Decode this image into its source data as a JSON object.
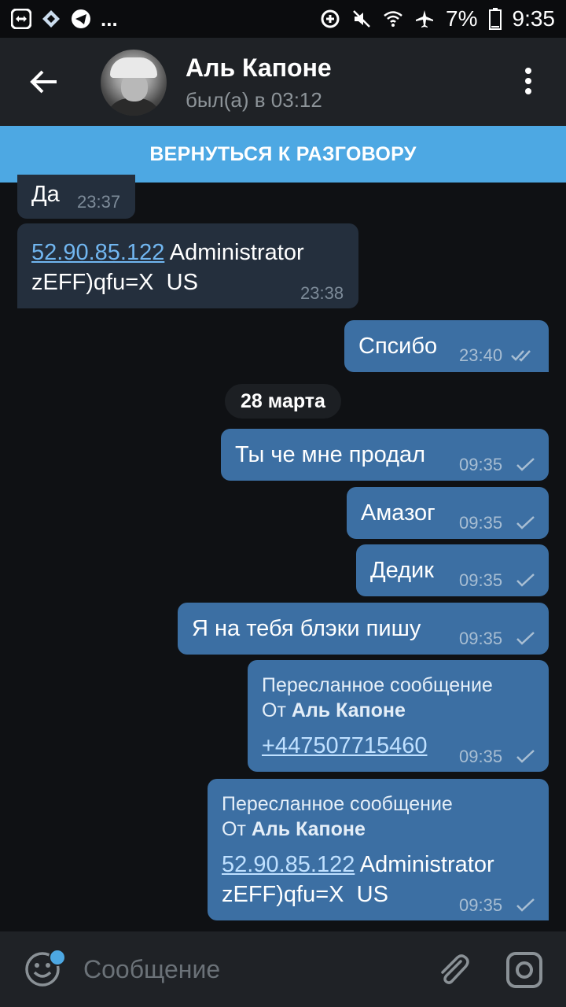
{
  "status_bar": {
    "more": "...",
    "battery": "7%",
    "time": "9:35"
  },
  "header": {
    "back_icon": "arrow-left-icon",
    "contact_name": "Аль Капоне",
    "last_seen": "был(а) в 03:12",
    "menu_icon": "more-vertical-icon"
  },
  "banner": {
    "label": "ВЕРНУТЬСЯ К РАЗГОВОРУ"
  },
  "messages": [
    {
      "dir": "in",
      "text": "Да",
      "time": "23:37"
    },
    {
      "dir": "in",
      "link": "52.90.85.122",
      "text": " Administrator",
      "text2": "zEFF)qfu=X  US",
      "time": "23:38"
    },
    {
      "dir": "out",
      "text": "Спсибо",
      "time": "23:40",
      "status": "read"
    },
    {
      "dir": "out",
      "text": "Ты че мне продал",
      "time": "09:35",
      "status": "sent"
    },
    {
      "dir": "out",
      "text": "Амазог",
      "time": "09:35",
      "status": "sent"
    },
    {
      "dir": "out",
      "text": "Дедик",
      "time": "09:35",
      "status": "sent"
    },
    {
      "dir": "out",
      "text": "Я на тебя блэки пишу",
      "time": "09:35",
      "status": "sent"
    },
    {
      "dir": "out",
      "forward_title": "Пересланное сообщение",
      "forward_prefix": "От ",
      "forward_name": "Аль Капоне",
      "link": "+447507715460",
      "time": "09:35",
      "status": "sent"
    },
    {
      "dir": "out",
      "forward_title": "Пересланное сообщение",
      "forward_prefix": "От ",
      "forward_name": "Аль Капоне",
      "link": "52.90.85.122",
      "text": " Administrator",
      "text2": "zEFF)qfu=X  US",
      "time": "09:35",
      "status": "sent"
    }
  ],
  "date_separator": "28 марта",
  "composer": {
    "placeholder": "Сообщение",
    "emoji_icon": "emoji-icon",
    "attach_icon": "paperclip-icon",
    "camera_icon": "camera-icon"
  },
  "colors": {
    "banner": "#4da8e3",
    "outgoing_bubble": "#3c6fa3",
    "incoming_bubble": "#242f3d",
    "background": "#0f1114"
  }
}
